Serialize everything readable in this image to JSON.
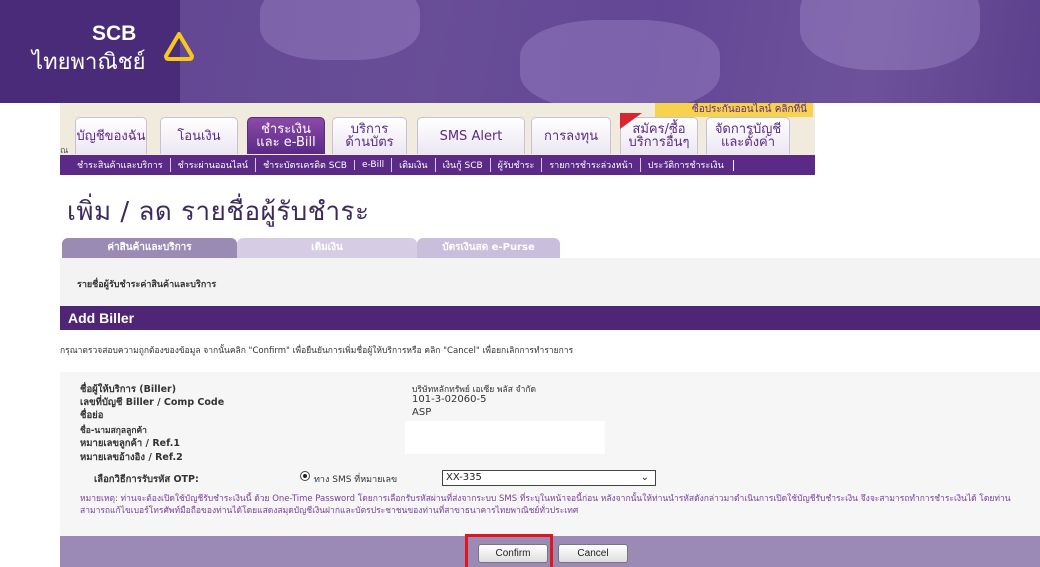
{
  "brand": {
    "name": "SCB",
    "thai_name": "ไทยพาณิชย์"
  },
  "promo": "ซื้อประกันออนไลน์ คลิกที่นี่",
  "tab_edge": "ณ",
  "main_tabs": [
    {
      "line1": "บัญชีของฉัน",
      "line2": ""
    },
    {
      "line1": "โอนเงิน",
      "line2": ""
    },
    {
      "line1": "ชำระเงิน",
      "line2": "และ e-Bill"
    },
    {
      "line1": "บริการ",
      "line2": "ด้านบัตร"
    },
    {
      "line1": "SMS Alert",
      "line2": ""
    },
    {
      "line1": "การลงทุน",
      "line2": ""
    },
    {
      "line1": "สมัคร/ซื้อ",
      "line2": "บริการอื่นๆ"
    },
    {
      "line1": "จัดการบัญชี",
      "line2": "และตั้งค่า"
    }
  ],
  "sub_nav": [
    "ชำระสินค้าและบริการ",
    "ชำระผ่านออนไลน์",
    "ชำระบัตรเครดิต SCB",
    "e-Bill",
    "เติมเงิน",
    "เงินกู้ SCB",
    "ผู้รับชำระ",
    "รายการชำระล่วงหน้า",
    "ประวัติการชำระเงิน"
  ],
  "page_title": "เพิ่ม / ลด รายชื่อผู้รับชำระ",
  "content_tabs": [
    "ค่าสินค้าและบริการ",
    "เติมเงิน",
    "บัตรเงินสด e-Purse"
  ],
  "subheading": "รายชื่อผู้รับชำระค่าสินค้าและบริการ",
  "add_biller_title": "Add Biller",
  "instruction": "กรุณาตรวจสอบความถูกต้องของข้อมูล จากนั้นคลิก \"Confirm\" เพื่อยืนยันการเพิ่มชื่อผู้ให้บริการหรือ คลิก \"Cancel\" เพื่อยกเลิกการทำรายการ",
  "fields": [
    {
      "label": "ชื่อผู้ให้บริการ (Biller)",
      "value": "บริษัทหลักทรัพย์ เอเซีย พลัส จำกัด"
    },
    {
      "label": "เลขที่บัญชี Biller / Comp Code",
      "value": "101-3-02060-5"
    },
    {
      "label": "ชื่อย่อ",
      "value": "ASP"
    },
    {
      "label": "ชื่อ-นามสกุลลูกค้า",
      "value": ""
    },
    {
      "label": "หมายเลขลูกค้า / Ref.1",
      "value": ""
    },
    {
      "label": "หมายเลขอ้างอิง / Ref.2",
      "value": ""
    }
  ],
  "otp": {
    "label": "เลือกวิธีการรับรหัส OTP:",
    "radio_label": "ทาง SMS ที่หมายเลข",
    "selected_phone": "XX-335"
  },
  "note": "หมายเหตุ: ท่านจะต้องเปิดใช้บัญชีรับชำระเงินนี้ ด้วย One-Time Password โดยการเลือกรับรหัสผ่านที่ส่งจากระบบ SMS ที่ระบุในหน้าจอนี้ก่อน หลังจากนั้นให้ท่านนำรหัสดังกล่าวมาดำเนินการเปิดใช้บัญชีรับชำระเงิน จึงจะสามารถทำการชำระเงินได้ โดยท่านสามารถแก้ไขเบอร์โทรศัพท์มือถือของท่านได้โดยแสดงสมุดบัญชีเงินฝากและบัตรประชาชนของท่านที่สาขาธนาคารไทยพาณิชย์ทั่วประเทศ",
  "buttons": {
    "confirm": "Confirm",
    "cancel": "Cancel"
  },
  "colors": {
    "brand_purple": "#4f2575",
    "accent_gold": "#f6d24d",
    "highlight_red": "#e0151d"
  }
}
